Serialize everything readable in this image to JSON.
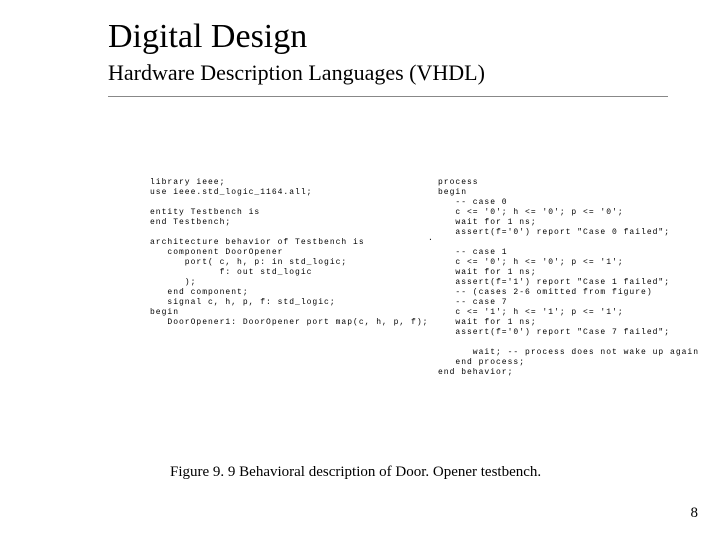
{
  "title": "Digital Design",
  "subtitle": "Hardware Description Languages (VHDL)",
  "code_left": "library ieee;\nuse ieee.std_logic_1164.all;\n\nentity Testbench is\nend Testbench;\n\narchitecture behavior of Testbench is\n   component DoorOpener\n      port( c, h, p: in std_logic;\n            f: out std_logic\n      );\n   end component;\n   signal c, h, p, f: std_logic;\nbegin\n   DoorOpener1: DoorOpener port map(c, h, p, f);",
  "code_right": "process\nbegin\n   -- case 0\n   c <= '0'; h <= '0'; p <= '0';\n   wait for 1 ns;\n   assert(f='0') report \"Case 0 failed\";\n\n   -- case 1\n   c <= '0'; h <= '0'; p <= '1';\n   wait for 1 ns;\n   assert(f='1') report \"Case 1 failed\";\n   -- (cases 2-6 omitted from figure)\n   -- case 7\n   c <= '1'; h <= '1'; p <= '1';\n   wait for 1 ns;\n   assert(f='0') report \"Case 7 failed\";\n\n      wait; -- process does not wake up again\n   end process;\nend behavior;",
  "dot": ".",
  "caption": "Figure 9. 9 Behavioral description of Door. Opener testbench.",
  "pagenum": "8"
}
